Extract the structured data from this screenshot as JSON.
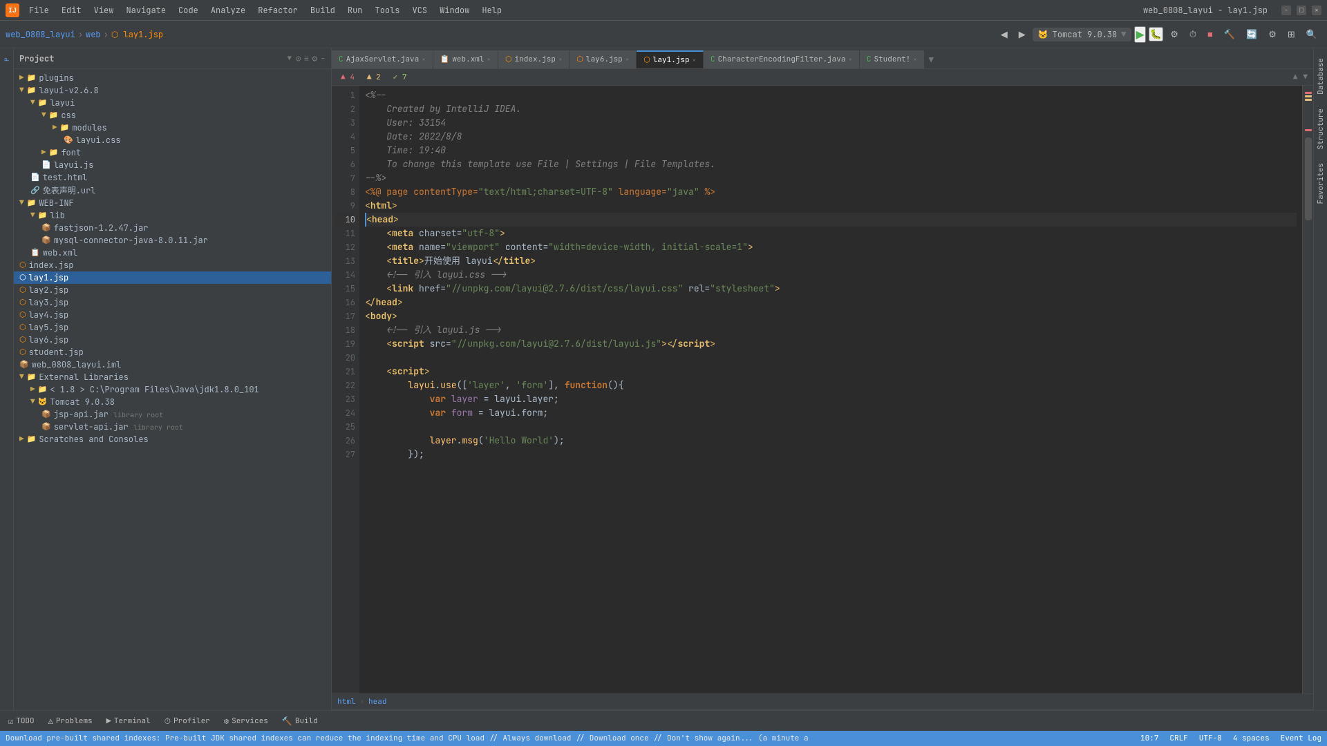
{
  "titleBar": {
    "appIcon": "IJ",
    "projectName": "web_0808_layui",
    "fileName": "lay1.jsp",
    "windowTitle": "web_0808_layui - lay1.jsp",
    "menuItems": [
      "File",
      "Edit",
      "View",
      "Navigate",
      "Code",
      "Analyze",
      "Refactor",
      "Build",
      "Run",
      "Tools",
      "VCS",
      "Window",
      "Help"
    ],
    "controls": [
      "−",
      "□",
      "×"
    ]
  },
  "toolbar": {
    "breadcrumb": [
      "web_0808_layui",
      "web",
      "lay1.jsp"
    ],
    "runConfig": "Tomcat 9.0.38",
    "backLabel": "◀",
    "forwardLabel": "▶"
  },
  "projectPanel": {
    "title": "Project",
    "tree": [
      {
        "level": 0,
        "icon": "📁",
        "name": "plugins",
        "type": "folder",
        "expanded": false
      },
      {
        "level": 0,
        "icon": "📁",
        "name": "layui-v2.6.8",
        "type": "folder",
        "expanded": true
      },
      {
        "level": 1,
        "icon": "📁",
        "name": "layui",
        "type": "folder",
        "expanded": true
      },
      {
        "level": 2,
        "icon": "📁",
        "name": "css",
        "type": "folder",
        "expanded": true
      },
      {
        "level": 3,
        "icon": "📁",
        "name": "modules",
        "type": "folder",
        "expanded": false
      },
      {
        "level": 3,
        "icon": "🎨",
        "name": "layui.css",
        "type": "css"
      },
      {
        "level": 2,
        "icon": "📁",
        "name": "font",
        "type": "folder",
        "expanded": false
      },
      {
        "level": 2,
        "icon": "📄",
        "name": "layui.js",
        "type": "js"
      },
      {
        "level": 1,
        "icon": "📄",
        "name": "test.html",
        "type": "html"
      },
      {
        "level": 1,
        "icon": "🔗",
        "name": "免表声明.url",
        "type": "url"
      },
      {
        "level": 0,
        "icon": "📁",
        "name": "WEB-INF",
        "type": "folder",
        "expanded": true
      },
      {
        "level": 1,
        "icon": "📁",
        "name": "lib",
        "type": "folder",
        "expanded": true
      },
      {
        "level": 2,
        "icon": "📦",
        "name": "fastjson-1.2.47.jar",
        "type": "jar"
      },
      {
        "level": 2,
        "icon": "📦",
        "name": "mysql-connector-java-8.0.11.jar",
        "type": "jar"
      },
      {
        "level": 1,
        "icon": "📋",
        "name": "web.xml",
        "type": "xml"
      },
      {
        "level": 0,
        "icon": "📄",
        "name": "index.jsp",
        "type": "jsp"
      },
      {
        "level": 0,
        "icon": "📄",
        "name": "lay1.jsp",
        "type": "jsp",
        "selected": true
      },
      {
        "level": 0,
        "icon": "📄",
        "name": "lay2.jsp",
        "type": "jsp"
      },
      {
        "level": 0,
        "icon": "📄",
        "name": "lay3.jsp",
        "type": "jsp"
      },
      {
        "level": 0,
        "icon": "📄",
        "name": "lay4.jsp",
        "type": "jsp"
      },
      {
        "level": 0,
        "icon": "📄",
        "name": "lay5.jsp",
        "type": "jsp"
      },
      {
        "level": 0,
        "icon": "📄",
        "name": "lay6.jsp",
        "type": "jsp"
      },
      {
        "level": 0,
        "icon": "📄",
        "name": "student.jsp",
        "type": "jsp"
      },
      {
        "level": 0,
        "icon": "📦",
        "name": "web_0808_layui.iml",
        "type": "iml"
      },
      {
        "level": 0,
        "icon": "📁",
        "name": "External Libraries",
        "type": "folder",
        "expanded": true
      },
      {
        "level": 1,
        "icon": "📁",
        "name": "< 1.8 > C:\\Program Files\\Java\\jdk1.8.0_101",
        "type": "folder",
        "expanded": false
      },
      {
        "level": 1,
        "icon": "📁",
        "name": "Tomcat 9.0.38",
        "type": "folder",
        "expanded": true
      },
      {
        "level": 2,
        "icon": "📦",
        "name": "jsp-api.jar",
        "type": "jar",
        "extra": "library root"
      },
      {
        "level": 2,
        "icon": "📦",
        "name": "servlet-api.jar",
        "type": "jar",
        "extra": "library root"
      },
      {
        "level": 0,
        "icon": "📁",
        "name": "Scratches and Consoles",
        "type": "folder",
        "expanded": false
      }
    ]
  },
  "tabs": [
    {
      "name": "AjaxServlet.java",
      "type": "java",
      "active": false
    },
    {
      "name": "web.xml",
      "type": "xml",
      "active": false
    },
    {
      "name": "index.jsp",
      "type": "jsp",
      "active": false
    },
    {
      "name": "lay6.jsp",
      "type": "jsp",
      "active": false
    },
    {
      "name": "lay1.jsp",
      "type": "jsp",
      "active": true
    },
    {
      "name": "CharacterEncodingFilter.java",
      "type": "java",
      "active": false
    },
    {
      "name": "Student!",
      "type": "java",
      "active": false
    }
  ],
  "notifications": {
    "errors": "▲ 4",
    "warnings": "▲ 2",
    "ok": "✓ 7"
  },
  "code": {
    "lines": [
      {
        "num": 1,
        "tokens": [
          {
            "t": "comment",
            "v": "<%--"
          }
        ]
      },
      {
        "num": 2,
        "tokens": [
          {
            "t": "comment",
            "v": "    Created by IntelliJ IDEA."
          }
        ]
      },
      {
        "num": 3,
        "tokens": [
          {
            "t": "comment",
            "v": "    User: 33154"
          }
        ]
      },
      {
        "num": 4,
        "tokens": [
          {
            "t": "comment",
            "v": "    Date: 2022/8/8"
          }
        ]
      },
      {
        "num": 5,
        "tokens": [
          {
            "t": "comment",
            "v": "    Time: 19:40"
          }
        ]
      },
      {
        "num": 6,
        "tokens": [
          {
            "t": "comment",
            "v": "    To change this template use File | Settings | File Templates."
          }
        ]
      },
      {
        "num": 7,
        "tokens": [
          {
            "t": "comment",
            "v": "--%>"
          }
        ]
      },
      {
        "num": 8,
        "tokens": [
          {
            "t": "directive",
            "v": "<%@ page contentType="
          },
          {
            "t": "str",
            "v": "\"text/html;charset=UTF-8\""
          },
          {
            "t": "directive",
            "v": " language="
          },
          {
            "t": "str",
            "v": "\"java\""
          },
          {
            "t": "directive",
            "v": " %>"
          }
        ]
      },
      {
        "num": 9,
        "tokens": [
          {
            "t": "tag",
            "v": "<"
          },
          {
            "t": "kw",
            "v": "html"
          },
          {
            "t": "tag",
            "v": ">"
          }
        ]
      },
      {
        "num": 10,
        "tokens": [
          {
            "t": "tag",
            "v": "<"
          },
          {
            "t": "kw",
            "v": "head"
          },
          {
            "t": "tag",
            "v": ">"
          }
        ],
        "active": true
      },
      {
        "num": 11,
        "tokens": [
          {
            "t": "plain",
            "v": "    "
          },
          {
            "t": "tag",
            "v": "<"
          },
          {
            "t": "kw",
            "v": "meta"
          },
          {
            "t": "plain",
            "v": " "
          },
          {
            "t": "attr",
            "v": "charset"
          },
          {
            "t": "plain",
            "v": "="
          },
          {
            "t": "str",
            "v": "\"utf-8\""
          },
          {
            "t": "tag",
            "v": ">"
          }
        ]
      },
      {
        "num": 12,
        "tokens": [
          {
            "t": "plain",
            "v": "    "
          },
          {
            "t": "tag",
            "v": "<"
          },
          {
            "t": "kw",
            "v": "meta"
          },
          {
            "t": "plain",
            "v": " "
          },
          {
            "t": "attr",
            "v": "name"
          },
          {
            "t": "plain",
            "v": "="
          },
          {
            "t": "str",
            "v": "\"viewport\""
          },
          {
            "t": "plain",
            "v": " "
          },
          {
            "t": "attr",
            "v": "content"
          },
          {
            "t": "plain",
            "v": "="
          },
          {
            "t": "str",
            "v": "\"width=device-width, initial-scale=1\""
          },
          {
            "t": "tag",
            "v": ">"
          }
        ]
      },
      {
        "num": 13,
        "tokens": [
          {
            "t": "plain",
            "v": "    "
          },
          {
            "t": "tag",
            "v": "<"
          },
          {
            "t": "kw",
            "v": "title"
          },
          {
            "t": "tag",
            "v": ">"
          },
          {
            "t": "plain",
            "v": "开始使用 layui"
          },
          {
            "t": "tag",
            "v": "</"
          },
          {
            "t": "kw",
            "v": "title"
          },
          {
            "t": "tag",
            "v": ">"
          }
        ]
      },
      {
        "num": 14,
        "tokens": [
          {
            "t": "plain",
            "v": "    "
          },
          {
            "t": "comment",
            "v": "<!-- 引入 layui.css -->"
          }
        ]
      },
      {
        "num": 15,
        "tokens": [
          {
            "t": "plain",
            "v": "    "
          },
          {
            "t": "tag",
            "v": "<"
          },
          {
            "t": "kw",
            "v": "link"
          },
          {
            "t": "plain",
            "v": " "
          },
          {
            "t": "attr",
            "v": "href"
          },
          {
            "t": "plain",
            "v": "="
          },
          {
            "t": "str",
            "v": "\"//unpkg.com/layui@2.7.6/dist/css/layui.css\""
          },
          {
            "t": "plain",
            "v": " "
          },
          {
            "t": "attr",
            "v": "rel"
          },
          {
            "t": "plain",
            "v": "="
          },
          {
            "t": "str",
            "v": "\"stylesheet\""
          },
          {
            "t": "tag",
            "v": ">"
          }
        ]
      },
      {
        "num": 16,
        "tokens": [
          {
            "t": "tag",
            "v": "</"
          },
          {
            "t": "kw",
            "v": "head"
          },
          {
            "t": "tag",
            "v": ">"
          }
        ]
      },
      {
        "num": 17,
        "tokens": [
          {
            "t": "tag",
            "v": "<"
          },
          {
            "t": "kw",
            "v": "body"
          },
          {
            "t": "tag",
            "v": ">"
          }
        ]
      },
      {
        "num": 18,
        "tokens": [
          {
            "t": "plain",
            "v": "    "
          },
          {
            "t": "comment",
            "v": "<!-- 引入 layui.js -->"
          }
        ]
      },
      {
        "num": 19,
        "tokens": [
          {
            "t": "plain",
            "v": "    "
          },
          {
            "t": "tag",
            "v": "<"
          },
          {
            "t": "kw",
            "v": "script"
          },
          {
            "t": "plain",
            "v": " "
          },
          {
            "t": "attr",
            "v": "src"
          },
          {
            "t": "plain",
            "v": "="
          },
          {
            "t": "str",
            "v": "\"//unpkg.com/layui@2.7.6/dist/layui.js\""
          },
          {
            "t": "tag",
            "v": "></"
          },
          {
            "t": "kw",
            "v": "script"
          },
          {
            "t": "tag",
            "v": ">"
          }
        ]
      },
      {
        "num": 20,
        "tokens": [
          {
            "t": "plain",
            "v": ""
          }
        ]
      },
      {
        "num": 21,
        "tokens": [
          {
            "t": "plain",
            "v": "    "
          },
          {
            "t": "tag",
            "v": "<"
          },
          {
            "t": "kw",
            "v": "script"
          },
          {
            "t": "tag",
            "v": ">"
          }
        ]
      },
      {
        "num": 22,
        "tokens": [
          {
            "t": "plain",
            "v": "        "
          },
          {
            "t": "method",
            "v": "layui"
          },
          {
            "t": "plain",
            "v": "."
          },
          {
            "t": "method",
            "v": "use"
          },
          {
            "t": "plain",
            "v": "(["
          },
          {
            "t": "str",
            "v": "'layer'"
          },
          {
            "t": "plain",
            "v": ", "
          },
          {
            "t": "str",
            "v": "'form'"
          },
          {
            "t": "plain",
            "v": "], "
          },
          {
            "t": "kw",
            "v": "function"
          },
          {
            "t": "plain",
            "v": "(){"
          }
        ]
      },
      {
        "num": 23,
        "tokens": [
          {
            "t": "plain",
            "v": "            "
          },
          {
            "t": "kw",
            "v": "var"
          },
          {
            "t": "plain",
            "v": " "
          },
          {
            "t": "var-name",
            "v": "layer"
          },
          {
            "t": "plain",
            "v": " = layui.layer;"
          }
        ]
      },
      {
        "num": 24,
        "tokens": [
          {
            "t": "plain",
            "v": "            "
          },
          {
            "t": "kw",
            "v": "var"
          },
          {
            "t": "plain",
            "v": " "
          },
          {
            "t": "var-name",
            "v": "form"
          },
          {
            "t": "plain",
            "v": " = layui.form;"
          }
        ]
      },
      {
        "num": 25,
        "tokens": [
          {
            "t": "plain",
            "v": ""
          }
        ]
      },
      {
        "num": 26,
        "tokens": [
          {
            "t": "plain",
            "v": "            "
          },
          {
            "t": "method",
            "v": "layer"
          },
          {
            "t": "plain",
            "v": "."
          },
          {
            "t": "method",
            "v": "msg"
          },
          {
            "t": "plain",
            "v": "("
          },
          {
            "t": "str",
            "v": "'Hello World'"
          },
          {
            "t": "plain",
            "v": ");"
          }
        ]
      },
      {
        "num": 27,
        "tokens": [
          {
            "t": "plain",
            "v": "        "
          },
          {
            "t": "plain",
            "v": "});"
          }
        ]
      }
    ]
  },
  "breadcrumbPath": [
    "html",
    "head"
  ],
  "bottomTools": [
    {
      "icon": "☑",
      "label": "TODO"
    },
    {
      "icon": "⚠",
      "label": "Problems"
    },
    {
      "icon": "▶",
      "label": "Terminal"
    },
    {
      "icon": "⏱",
      "label": "Profiler"
    },
    {
      "icon": "⚙",
      "label": "Services"
    },
    {
      "icon": "🔨",
      "label": "Build"
    }
  ],
  "statusBar": {
    "position": "10:7",
    "lineEnding": "CRLF",
    "encoding": "UTF-8",
    "indent": "4 spaces",
    "message": "Download pre-built shared indexes: Pre-built JDK shared indexes can reduce the indexing time and CPU load // Always download // Download once // Don't show again... (a minute a",
    "eventLog": "Event Log"
  },
  "rightPanel": {
    "tabs": [
      "Database",
      "Structure",
      "Favorites"
    ]
  },
  "colors": {
    "accent": "#4a90d9",
    "background": "#2b2b2b",
    "panel": "#3c3f41",
    "selected": "#2d6099",
    "keyword": "#cc7832",
    "string": "#6a8759",
    "comment": "#808080",
    "tag": "#e8bf6a",
    "method": "#ffc66d",
    "variable": "#9876aa",
    "error": "#e06c75",
    "warning": "#e5c07b",
    "ok": "#98c379"
  }
}
